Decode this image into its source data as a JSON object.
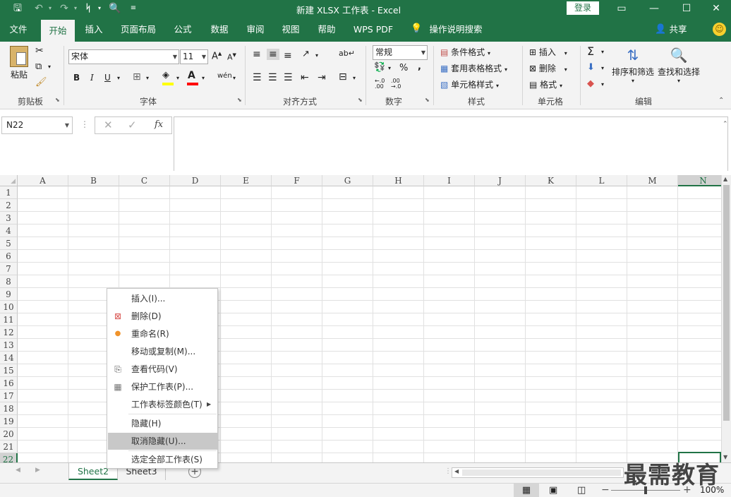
{
  "window": {
    "title": "新建 XLSX 工作表  -  Excel",
    "login_label": "登录",
    "accent": "#217346"
  },
  "tabs": [
    {
      "label": "文件"
    },
    {
      "label": "开始"
    },
    {
      "label": "插入"
    },
    {
      "label": "页面布局"
    },
    {
      "label": "公式"
    },
    {
      "label": "数据"
    },
    {
      "label": "审阅"
    },
    {
      "label": "视图"
    },
    {
      "label": "帮助"
    },
    {
      "label": "WPS PDF"
    },
    {
      "label": "操作说明搜索"
    }
  ],
  "share_label": "共享",
  "ribbon": {
    "clipboard": {
      "paste": "粘贴",
      "group": "剪贴板"
    },
    "font": {
      "name": "宋体",
      "size": "11",
      "group": "字体",
      "bold": "B",
      "italic": "I",
      "underline": "U"
    },
    "alignment": {
      "group": "对齐方式"
    },
    "number": {
      "format": "常规",
      "group": "数字",
      "percent": "%",
      "comma": ","
    },
    "styles": {
      "conditional": "条件格式",
      "table": "套用表格格式",
      "cell": "单元格样式",
      "group": "样式"
    },
    "cells": {
      "insert": "插入",
      "delete": "删除",
      "format": "格式",
      "group": "单元格"
    },
    "editing": {
      "sort": "排序和筛选",
      "find": "查找和选择",
      "group": "编辑"
    }
  },
  "formula_bar": {
    "name_box": "N22",
    "fx": "fx",
    "value": ""
  },
  "columns": [
    "A",
    "B",
    "C",
    "D",
    "E",
    "F",
    "G",
    "H",
    "I",
    "J",
    "K",
    "L",
    "M",
    "N"
  ],
  "rows": [
    "1",
    "2",
    "3",
    "4",
    "5",
    "6",
    "7",
    "8",
    "9",
    "10",
    "11",
    "12",
    "13",
    "14",
    "15",
    "16",
    "17",
    "18",
    "19",
    "20",
    "21",
    "22"
  ],
  "sheets": [
    {
      "name": "Sheet2",
      "active": true
    },
    {
      "name": "Sheet3",
      "active": false
    }
  ],
  "context_menu": [
    {
      "label": "插入(I)...",
      "icon": ""
    },
    {
      "label": "删除(D)",
      "icon": "delete-sheet-icon"
    },
    {
      "label": "重命名(R)",
      "icon": "dot-icon"
    },
    {
      "label": "移动或复制(M)...",
      "icon": ""
    },
    {
      "label": "查看代码(V)",
      "icon": "view-code-icon"
    },
    {
      "label": "保护工作表(P)...",
      "icon": "protect-sheet-icon"
    },
    {
      "label": "工作表标签颜色(T)",
      "icon": "",
      "submenu": true
    },
    {
      "label": "隐藏(H)",
      "icon": ""
    },
    {
      "label": "取消隐藏(U)...",
      "icon": "",
      "highlighted": true
    },
    {
      "label": "选定全部工作表(S)",
      "icon": ""
    }
  ],
  "status": {
    "zoom": "100%"
  },
  "watermark": "最需教育"
}
